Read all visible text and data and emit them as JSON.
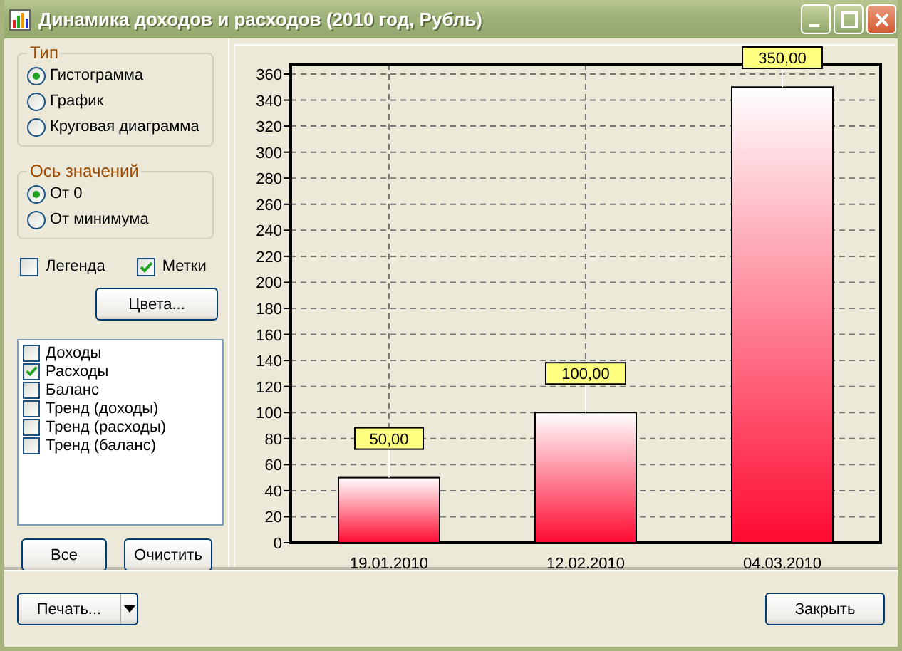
{
  "window": {
    "title": "Динамика доходов и расходов (2010 год, Рубль)"
  },
  "type_group": {
    "title": "Тип",
    "options": [
      {
        "label": "Гистограмма",
        "selected": true
      },
      {
        "label": "График",
        "selected": false
      },
      {
        "label": "Круговая диаграмма",
        "selected": false
      }
    ]
  },
  "axis_group": {
    "title": "Ось значений",
    "options": [
      {
        "label": "От 0",
        "selected": true
      },
      {
        "label": "От минимума",
        "selected": false
      }
    ]
  },
  "checkboxes": [
    {
      "label": "Легенда",
      "checked": false
    },
    {
      "label": "Метки",
      "checked": true
    }
  ],
  "colors_button": "Цвета...",
  "series_list": [
    {
      "label": "Доходы",
      "checked": false
    },
    {
      "label": "Расходы",
      "checked": true
    },
    {
      "label": "Баланс",
      "checked": false
    },
    {
      "label": "Тренд (доходы)",
      "checked": false
    },
    {
      "label": "Тренд (расходы)",
      "checked": false
    },
    {
      "label": "Тренд (баланс)",
      "checked": false
    }
  ],
  "list_buttons": [
    "Все",
    "Очистить"
  ],
  "chart": {
    "chart_data": {
      "type": "bar",
      "categories": [
        "19.01.2010",
        "12.02.2010",
        "04.03.2010"
      ],
      "series": [
        {
          "values": [
            50,
            100,
            350
          ]
        }
      ],
      "ylim": [
        0,
        360
      ],
      "grid": true,
      "yticks": [
        0,
        20,
        40,
        60,
        80,
        100,
        120,
        140,
        160,
        180,
        200,
        220,
        240,
        260,
        280,
        300,
        320,
        340,
        360
      ],
      "value_labels": [
        "50,00",
        "100,00",
        "350,00"
      ]
    }
  },
  "footer": {
    "print_button": "Печать...",
    "close_button": "Закрыть"
  }
}
